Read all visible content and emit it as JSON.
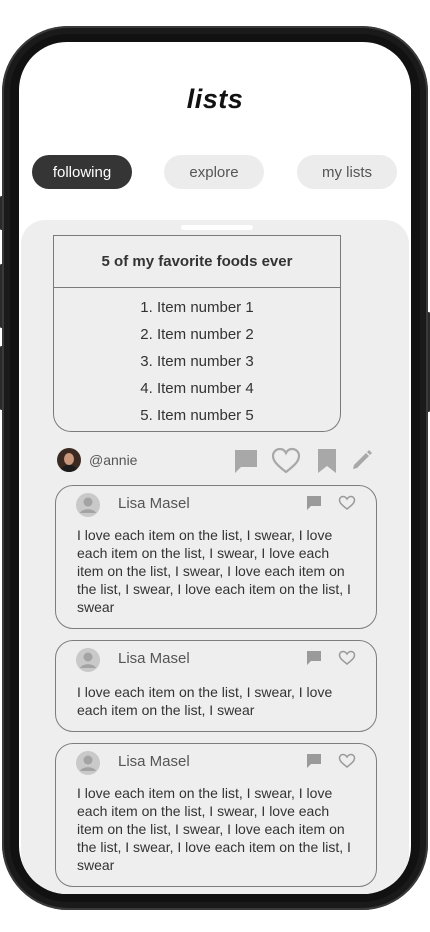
{
  "app": {
    "title": "lists"
  },
  "tabs": [
    {
      "label": "following",
      "active": true
    },
    {
      "label": "explore",
      "active": false
    },
    {
      "label": "my lists",
      "active": false
    }
  ],
  "list_card": {
    "title": "5 of my favorite foods ever",
    "items": [
      "1. Item number 1",
      "2. Item number 2",
      "3. Item number 3",
      "4. Item number 4",
      "5. Item number 5"
    ]
  },
  "post": {
    "username": "@annie",
    "actions": [
      "comment-icon",
      "heart-icon",
      "bookmark-icon",
      "edit-icon"
    ]
  },
  "comments": [
    {
      "name": "Lisa Masel",
      "text": "I love each item on the list, I swear, I love each item on the list, I swear, I love each item on the list, I swear, I love each item on the list, I swear, I love each item on the list, I swear"
    },
    {
      "name": "Lisa Masel",
      "text": "I love each item on the list, I swear, I love each item on the list, I swear"
    },
    {
      "name": "Lisa Masel",
      "text": "I love each item on the list, I swear, I love each item on the list, I swear, I love each item on the list, I swear, I love each item on the list, I swear, I love each item on the list, I swear"
    }
  ],
  "colors": {
    "accent": "#353535",
    "sheet": "#eeeeee",
    "icon": "#a8a8a8"
  }
}
